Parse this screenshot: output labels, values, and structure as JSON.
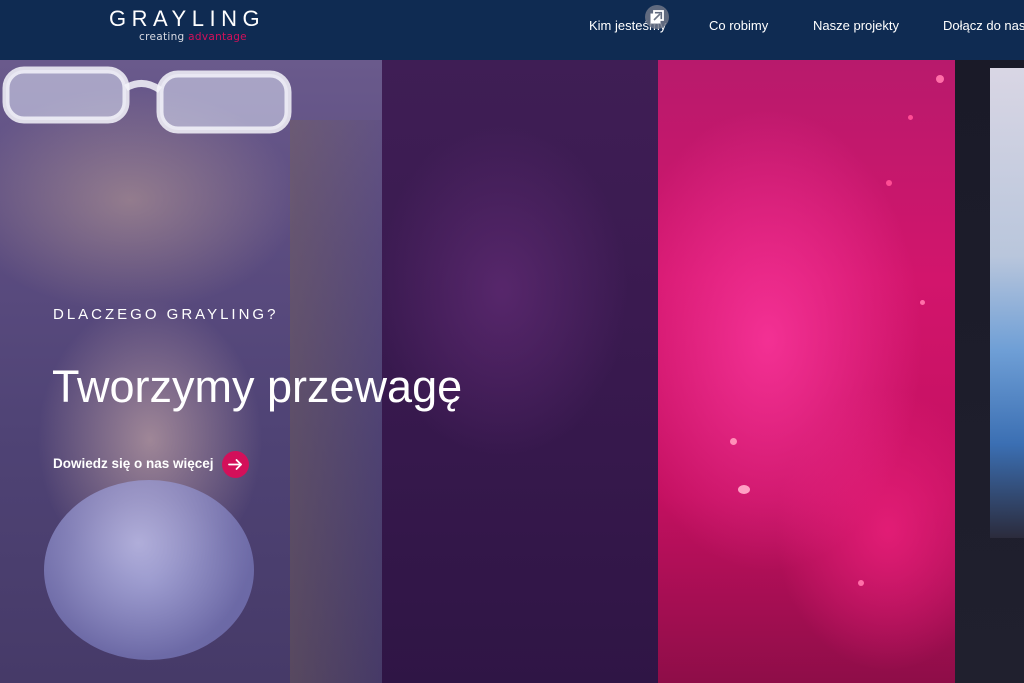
{
  "brand": {
    "name": "GRAYLING",
    "tagline_part1": "creating",
    "tagline_part2": "advantage",
    "accent_color": "#d3105a",
    "header_color": "#0f2b52"
  },
  "nav": {
    "items": [
      {
        "label": "Kim jesteśmy"
      },
      {
        "label": "Co robimy"
      },
      {
        "label": "Nasze projekty"
      },
      {
        "label": "Dołącz do nas"
      }
    ]
  },
  "hero": {
    "eyebrow": "DLACZEGO GRAYLING?",
    "headline": "Tworzymy przewagę",
    "cta_label": "Dowiedz się o nas więcej",
    "cta_icon": "arrow-right-icon"
  },
  "overlay": {
    "icon": "popout-icon"
  }
}
